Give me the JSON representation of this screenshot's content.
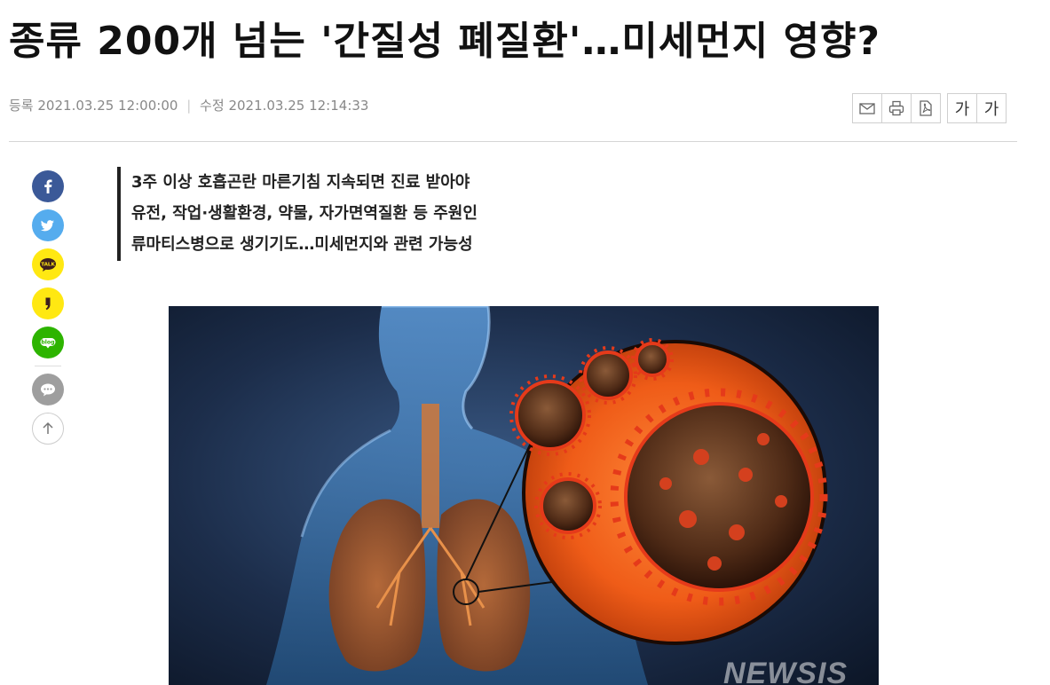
{
  "article": {
    "title": "종류 200개 넘는 '간질성 폐질환'…미세먼지 영향?",
    "registered_label": "등록",
    "registered_time": "2021.03.25 12:00:00",
    "modified_label": "수정",
    "modified_time": "2021.03.25 12:14:33",
    "summary": [
      "3주 이상 호흡곤란 마른기침 지속되면 진료 받아야",
      "유전, 작업·생활환경, 약물, 자가면역질환 등 주원인",
      "류마티스병으로 생기기도…미세먼지와 관련 가능성"
    ],
    "image_watermark": "NEWSIS"
  },
  "toolbar": {
    "font_small_label": "가",
    "font_large_label": "가",
    "icons": [
      "mail-icon",
      "print-icon",
      "pdf-icon"
    ]
  },
  "share": {
    "icons": [
      "facebook-icon",
      "twitter-icon",
      "kakaotalk-icon",
      "kakaostory-icon",
      "blog-icon",
      "comment-icon",
      "scroll-top-icon"
    ],
    "kakaotalk_text": "TALK",
    "blog_text": "blog",
    "colors": {
      "facebook": "#3b5998",
      "twitter": "#55acee",
      "kakao": "#ffe812",
      "blog": "#2db400",
      "comment": "#9e9e9e"
    }
  }
}
